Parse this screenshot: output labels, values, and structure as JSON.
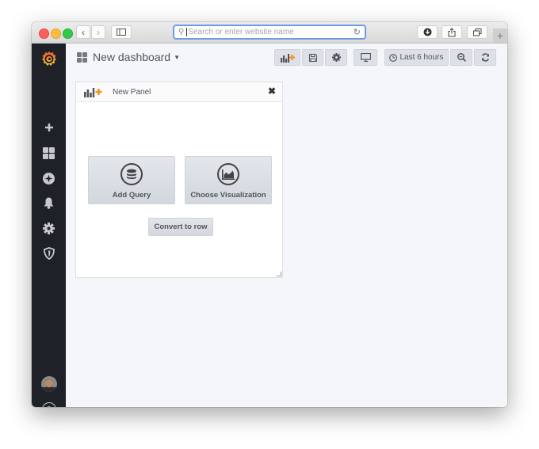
{
  "browser": {
    "address_placeholder": "Search or enter website name",
    "back_icon": "chevron-left-icon",
    "forward_icon": "chevron-right-icon",
    "new_tab_label": "+"
  },
  "sidebar": {
    "logo": "grafana-logo",
    "items": [
      {
        "name": "create",
        "icon": "plus-icon"
      },
      {
        "name": "dashboards",
        "icon": "grid-icon"
      },
      {
        "name": "explore",
        "icon": "compass-icon"
      },
      {
        "name": "alerting",
        "icon": "bell-icon"
      },
      {
        "name": "configuration",
        "icon": "gear-icon"
      },
      {
        "name": "server-admin",
        "icon": "shield-icon"
      }
    ],
    "help_label": "?"
  },
  "header": {
    "title": "New dashboard",
    "time_range_label": "Last 6 hours"
  },
  "panel": {
    "title": "New Panel",
    "close_label": "✖",
    "add_query_label": "Add Query",
    "choose_viz_label": "Choose Visualization",
    "convert_row_label": "Convert to row"
  },
  "colors": {
    "sidebar_bg": "#1f2129",
    "accent_orange": "#f7941d",
    "address_focus": "#6d9ae3"
  }
}
